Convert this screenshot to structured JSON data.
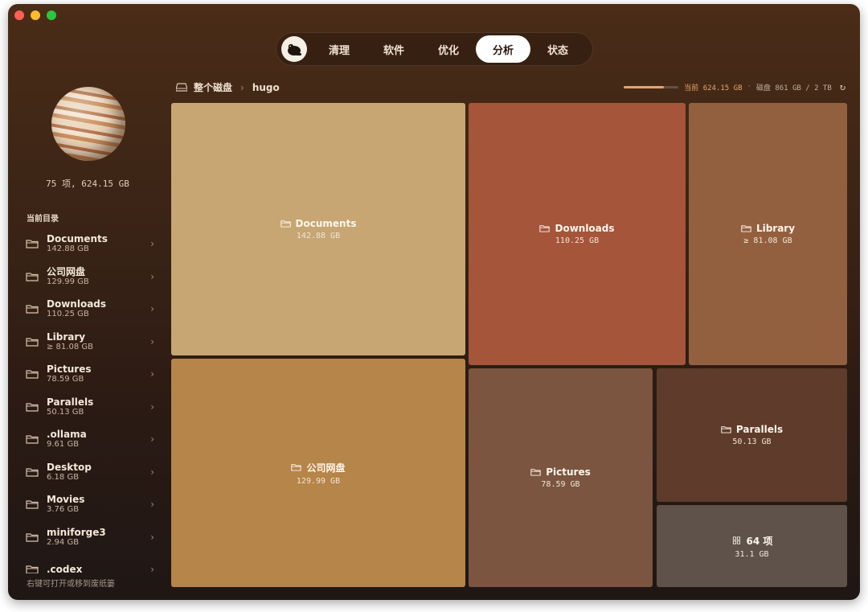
{
  "nav": {
    "tabs": [
      {
        "label": "清理"
      },
      {
        "label": "软件"
      },
      {
        "label": "优化"
      },
      {
        "label": "分析"
      },
      {
        "label": "状态"
      }
    ],
    "active": "分析"
  },
  "sidebar": {
    "summary": "75 项, 624.15 GB",
    "section_label": "当前目录",
    "items": [
      {
        "name": "Documents",
        "size": "142.88 GB"
      },
      {
        "name": "公司网盘",
        "size": "129.99 GB"
      },
      {
        "name": "Downloads",
        "size": "110.25 GB"
      },
      {
        "name": "Library",
        "size": "≥ 81.08 GB"
      },
      {
        "name": "Pictures",
        "size": "78.59 GB"
      },
      {
        "name": "Parallels",
        "size": "50.13 GB"
      },
      {
        "name": ".ollama",
        "size": "9.61 GB"
      },
      {
        "name": "Desktop",
        "size": "6.18 GB"
      },
      {
        "name": "Movies",
        "size": "3.76 GB"
      },
      {
        "name": "miniforge3",
        "size": "2.94 GB"
      },
      {
        "name": ".codex",
        "size": ""
      }
    ],
    "hint": "右键可打开或移到废纸篓"
  },
  "breadcrumb": {
    "root": "整个磁盘",
    "current": "hugo"
  },
  "usage": {
    "current_label": "当前 624.15 GB",
    "disk_label": "磁盘 861 GB / 2 TB",
    "fill_fraction": 0.73,
    "accent": "#e5a56c"
  },
  "treemap": {
    "tiles": [
      {
        "name": "Documents",
        "size": "142.88 GB",
        "color": "#c7a674"
      },
      {
        "name": "Downloads",
        "size": "110.25 GB",
        "color": "#a4553a"
      },
      {
        "name": "Library",
        "size": "≥ 81.08 GB",
        "color": "#93603f"
      },
      {
        "name": "公司网盘",
        "size": "129.99 GB",
        "color": "#b58549"
      },
      {
        "name": "Pictures",
        "size": "78.59 GB",
        "color": "#7b5540"
      },
      {
        "name": "Parallels",
        "size": "50.13 GB",
        "color": "#5e3b2a"
      },
      {
        "name": "64 项",
        "size": "31.1 GB",
        "color": "#5f524b"
      }
    ]
  }
}
